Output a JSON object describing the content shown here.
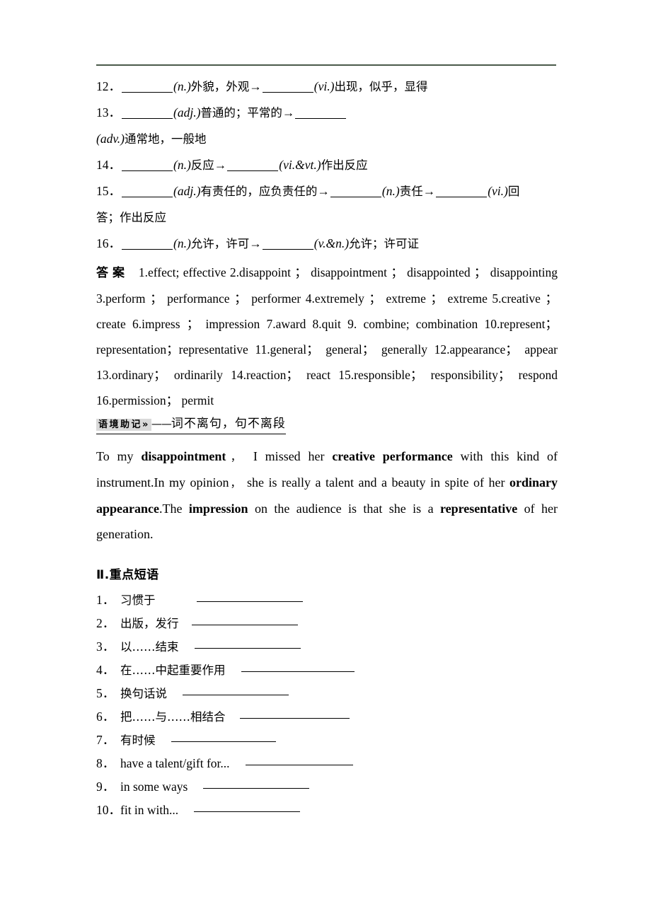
{
  "document": {
    "type": "english-study-workbook-page",
    "rule_color": "#4a5a4a"
  },
  "derivations": {
    "items": [
      {
        "number": "12．",
        "segments": [
          {
            "kind": "blank"
          },
          {
            "kind": "pos",
            "text": "(n.)"
          },
          {
            "kind": "cn",
            "text": "外貌，外观"
          },
          {
            "kind": "arrow",
            "text": "→"
          },
          {
            "kind": "blank"
          },
          {
            "kind": "pos",
            "text": "(vi.)"
          },
          {
            "kind": "cn",
            "text": "出现，似乎，显得"
          }
        ]
      },
      {
        "number": "13．",
        "segments": [
          {
            "kind": "blank"
          },
          {
            "kind": "pos",
            "text": "(adj.)"
          },
          {
            "kind": "cn",
            "text": "普通的；平常的"
          },
          {
            "kind": "arrow",
            "text": "→"
          },
          {
            "kind": "blank"
          },
          {
            "kind": "break"
          },
          {
            "kind": "pos",
            "text": "(adv.)"
          },
          {
            "kind": "cn",
            "text": "通常地，一般地"
          }
        ]
      },
      {
        "number": "14．",
        "segments": [
          {
            "kind": "blank"
          },
          {
            "kind": "pos",
            "text": "(n.)"
          },
          {
            "kind": "cn",
            "text": "反应"
          },
          {
            "kind": "arrow",
            "text": "→"
          },
          {
            "kind": "blank"
          },
          {
            "kind": "pos",
            "text": "(vi.&vt.)"
          },
          {
            "kind": "cn",
            "text": "作出反应"
          }
        ]
      },
      {
        "number": "15．",
        "segments": [
          {
            "kind": "blank"
          },
          {
            "kind": "pos",
            "text": "(adj.)"
          },
          {
            "kind": "cn",
            "text": "有责任的，应负责任的"
          },
          {
            "kind": "arrow",
            "text": "→"
          },
          {
            "kind": "blank"
          },
          {
            "kind": "pos",
            "text": "(n.)"
          },
          {
            "kind": "cn",
            "text": "责任"
          },
          {
            "kind": "arrow",
            "text": "→"
          },
          {
            "kind": "blank"
          },
          {
            "kind": "pos",
            "text": "(vi.)"
          },
          {
            "kind": "cn",
            "text": "回"
          },
          {
            "kind": "break"
          },
          {
            "kind": "cn",
            "text": "答；作出反应"
          }
        ]
      },
      {
        "number": "16．",
        "segments": [
          {
            "kind": "blank"
          },
          {
            "kind": "pos",
            "text": "(n.)"
          },
          {
            "kind": "cn",
            "text": "允许，许可"
          },
          {
            "kind": "arrow",
            "text": "→"
          },
          {
            "kind": "blank"
          },
          {
            "kind": "pos",
            "text": "(v.&n.)"
          },
          {
            "kind": "cn",
            "text": "允许；许可证"
          }
        ]
      }
    ]
  },
  "answers": {
    "label": "答案",
    "entries": [
      "1.effect; effective",
      "2.disappoint ； disappointment ； disappointed ； disappointing",
      "3.perform ； performance ； performer",
      "4.extremely ； extreme ； extreme",
      "5.creative ； create",
      "6.impress ； impression",
      "7.award",
      "8.quit",
      "9. combine; combination",
      "10.represent； representation；representative",
      "11.general； general； generally",
      "12.appearance； appear",
      "13.ordinary； ordinarily",
      "14.reaction； react",
      "15.responsible； responsibility； respond",
      "16.permission； permit"
    ],
    "full_text": "1.effect; effective  2.disappoint ； disappointment ； disappointed ； disappointing  3.perform ； performance ； performer  4.extremely ； extreme ； extreme  5.creative ； create  6.impress ； impression  7.award  8.quit  9. combine; combination  10.represent； representation；representative  11.general； general； generally  12.appearance； appear  13.ordinary； ordinarily  14.reaction； react  15.responsible； responsibility； respond  16.permission； permit"
  },
  "context_heading": {
    "tag": "语境助记»",
    "dash": "——",
    "subtitle": "词不离句，句不离段"
  },
  "paragraph": {
    "parts": [
      {
        "text": "To my ",
        "bold": false
      },
      {
        "text": "disappointment",
        "bold": true
      },
      {
        "text": "，",
        "bold": false,
        "cjk": true
      },
      {
        "text": " I missed her ",
        "bold": false
      },
      {
        "text": "creative performance",
        "bold": true
      },
      {
        "text": " with this kind of instrument.In my opinion",
        "bold": false
      },
      {
        "text": "，",
        "bold": false,
        "cjk": true
      },
      {
        "text": " she is really a talent and a beauty in spite of her ",
        "bold": false
      },
      {
        "text": "ordinary appearance",
        "bold": true
      },
      {
        "text": ".The ",
        "bold": false
      },
      {
        "text": "impression",
        "bold": true
      },
      {
        "text": " on the audience is that she is a ",
        "bold": false
      },
      {
        "text": "representative",
        "bold": true
      },
      {
        "text": " of her generation.",
        "bold": false
      }
    ]
  },
  "section_two": {
    "title": "Ⅱ.重点短语",
    "phrases": [
      {
        "number": "1．",
        "text": "习惯于",
        "cjk": true,
        "blank_width": 150,
        "gap": 58
      },
      {
        "number": "2．",
        "text": "出版，发行",
        "cjk": true,
        "blank_width": 150,
        "gap": 18
      },
      {
        "number": "3．",
        "text": "以……结束",
        "cjk": true,
        "blank_width": 150,
        "gap": 22
      },
      {
        "number": "4．",
        "text": "在……中起重要作用",
        "cjk": true,
        "blank_width": 160,
        "gap": 22
      },
      {
        "number": "5．",
        "text": "换句话说",
        "cjk": true,
        "blank_width": 150,
        "gap": 22
      },
      {
        "number": "6．",
        "text": "把……与……相结合",
        "cjk": true,
        "blank_width": 155,
        "gap": 20
      },
      {
        "number": "7．",
        "text": "有时候",
        "cjk": true,
        "blank_width": 148,
        "gap": 22
      },
      {
        "number": "8．",
        "text": "have a talent/gift for...",
        "cjk": false,
        "blank_width": 152,
        "gap": 22
      },
      {
        "number": "9．",
        "text": "in some ways",
        "cjk": false,
        "blank_width": 150,
        "gap": 22
      },
      {
        "number": "10．",
        "text": "fit in with...",
        "cjk": false,
        "blank_width": 150,
        "gap": 22
      }
    ]
  }
}
